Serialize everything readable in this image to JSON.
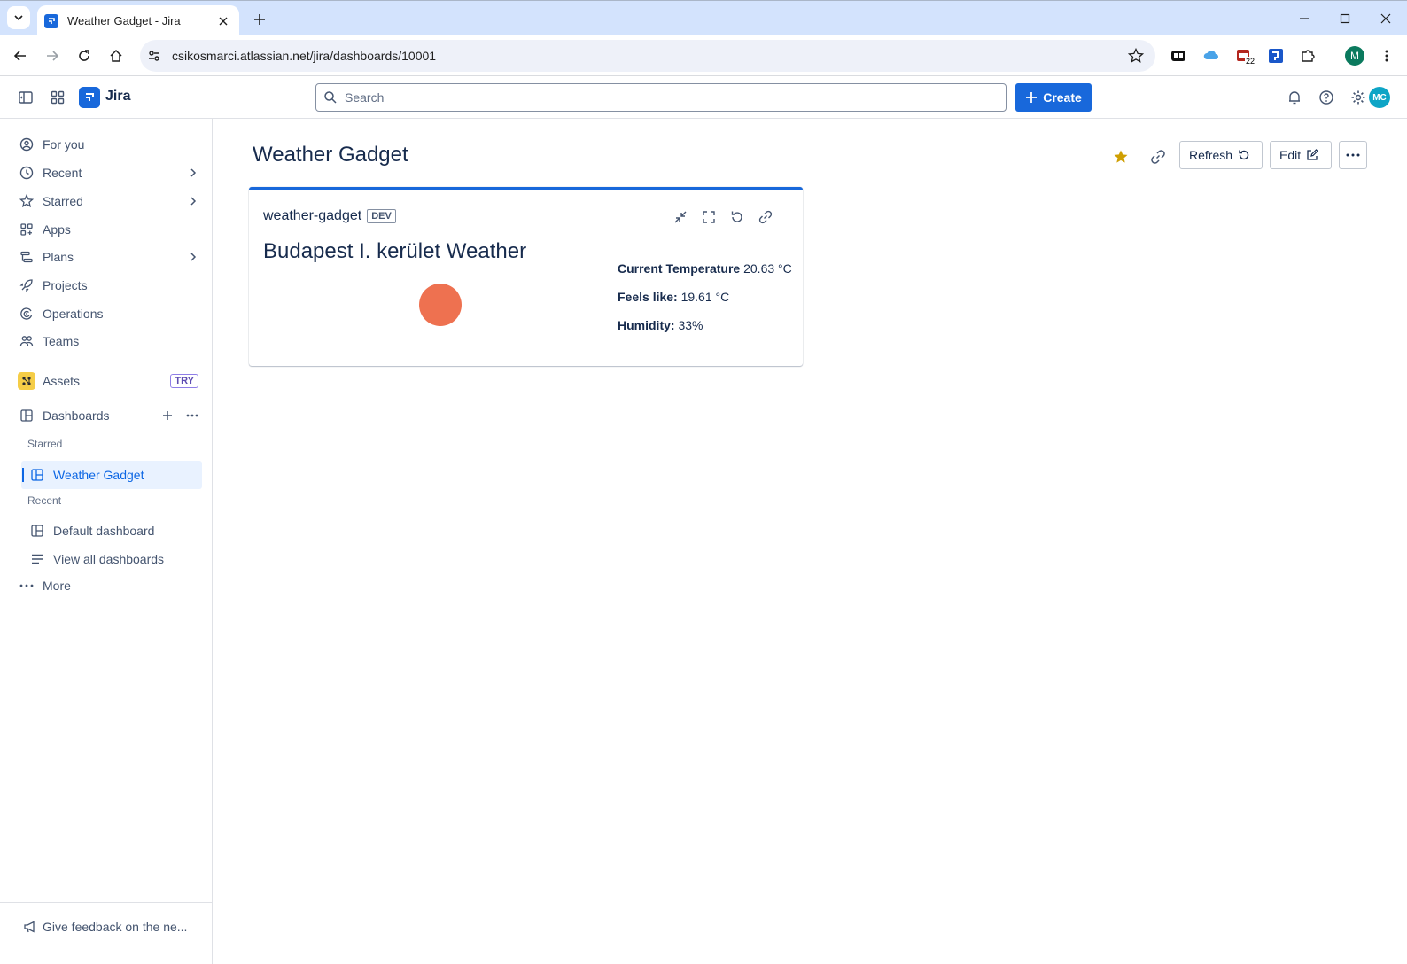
{
  "browser": {
    "tab_title": "Weather Gadget - Jira",
    "url": "csikosmarci.atlassian.net/jira/dashboards/10001",
    "profile_initial": "M",
    "extension_badge": "22"
  },
  "topnav": {
    "app_name": "Jira",
    "search_placeholder": "Search",
    "create_label": "Create",
    "avatar_initials": "MC"
  },
  "sidebar": {
    "items": [
      {
        "label": "For you"
      },
      {
        "label": "Recent"
      },
      {
        "label": "Starred"
      },
      {
        "label": "Apps"
      },
      {
        "label": "Plans"
      },
      {
        "label": "Projects"
      },
      {
        "label": "Operations"
      },
      {
        "label": "Teams"
      }
    ],
    "assets_label": "Assets",
    "assets_badge": "TRY",
    "dashboards_label": "Dashboards",
    "starred_section": "Starred",
    "starred_dashboard": "Weather Gadget",
    "recent_section": "Recent",
    "recent_dashboard": "Default dashboard",
    "view_all": "View all dashboards",
    "more": "More",
    "feedback": "Give feedback on the ne..."
  },
  "page": {
    "title": "Weather Gadget",
    "refresh_label": "Refresh",
    "edit_label": "Edit"
  },
  "gadget": {
    "name": "weather-gadget",
    "badge": "DEV",
    "city_title": "Budapest I. kerület Weather",
    "icon_color": "#ee7150",
    "temp_label": "Current Temperature",
    "temp_value": "20.63 °C",
    "feels_label": "Feels like:",
    "feels_value": "19.61 °C",
    "humidity_label": "Humidity:",
    "humidity_value": "33%"
  },
  "colors": {
    "brand": "#1868db",
    "star": "#cf9f02"
  }
}
